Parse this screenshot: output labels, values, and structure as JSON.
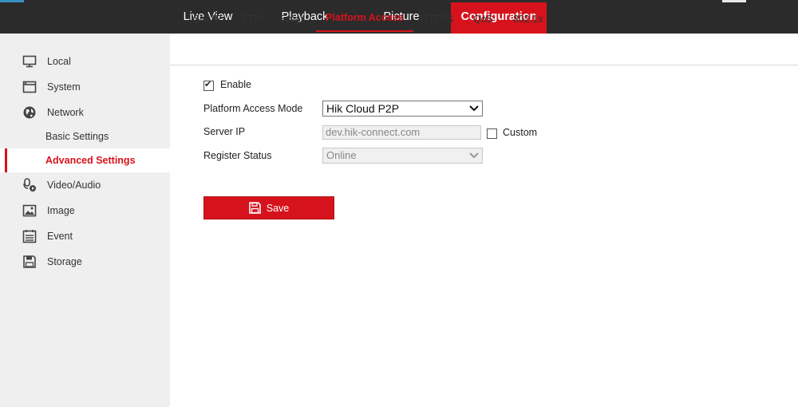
{
  "top_nav": {
    "tabs": [
      {
        "label": "Live View"
      },
      {
        "label": "Playback"
      },
      {
        "label": "Picture"
      },
      {
        "label": "Configuration",
        "active": true
      }
    ]
  },
  "sidebar": {
    "items": [
      {
        "label": "Local",
        "icon": "monitor-icon"
      },
      {
        "label": "System",
        "icon": "system-window-icon"
      },
      {
        "label": "Network",
        "icon": "globe-icon"
      },
      {
        "label": "Basic Settings"
      },
      {
        "label": "Advanced Settings",
        "active": true
      },
      {
        "label": "Video/Audio",
        "icon": "video-audio-icon"
      },
      {
        "label": "Image",
        "icon": "image-icon"
      },
      {
        "label": "Event",
        "icon": "event-calendar-icon"
      },
      {
        "label": "Storage",
        "icon": "storage-floppy-icon"
      }
    ]
  },
  "sub_tabs": [
    {
      "label": "SNMP"
    },
    {
      "label": "FTP"
    },
    {
      "label": "Email"
    },
    {
      "label": "Platform Access",
      "active": true
    },
    {
      "label": "HTTPS"
    },
    {
      "label": "QoS"
    },
    {
      "label": "802.1x"
    }
  ],
  "form": {
    "enable_label": "Enable",
    "enable_checked": true,
    "mode_label": "Platform Access Mode",
    "mode_value": "Hik Cloud P2P",
    "server_ip_label": "Server IP",
    "server_ip_value": "dev.hik-connect.com",
    "custom_label": "Custom",
    "custom_checked": false,
    "register_status_label": "Register Status",
    "register_status_value": "Online",
    "save_label": "Save"
  },
  "colors": {
    "accent": "#d6131c",
    "topbar": "#2b2b2b",
    "sidebar": "#efefef"
  }
}
